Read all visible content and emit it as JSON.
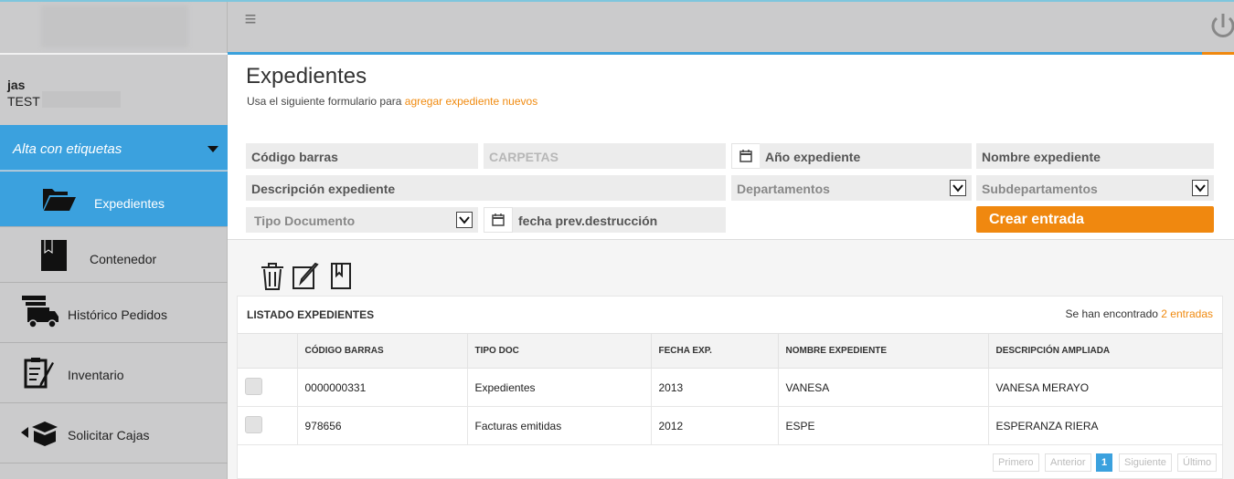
{
  "sidebar": {
    "user_name": "jas",
    "user_company": "TEST",
    "section": "Alta con etiquetas",
    "items": [
      {
        "label": "Expedientes",
        "icon": "folder-open-icon"
      },
      {
        "label": "Contenedor",
        "icon": "book-icon"
      },
      {
        "label": "Histórico Pedidos",
        "icon": "truck-icon"
      },
      {
        "label": "Inventario",
        "icon": "clipboard-pen-icon"
      },
      {
        "label": "Solicitar Cajas",
        "icon": "box-icon"
      }
    ]
  },
  "header": {
    "title": "Expedientes",
    "subtitle_prefix": "Usa el siguiente formulario para",
    "subtitle_link": "agregar expediente nuevos"
  },
  "form": {
    "codigo_barras": "Código barras",
    "carpetas": "CARPETAS",
    "ano_expediente": "Año expediente",
    "nombre_expediente": "Nombre expediente",
    "descripcion_expediente": "Descripción expediente",
    "departamentos": "Departamentos",
    "subdepartamentos": "Subdepartamentos",
    "tipo_documento": "Tipo Documento",
    "fecha_destruccion": "fecha prev.destrucción",
    "submit_label": "Crear entrada"
  },
  "toolbar": {
    "icons": [
      "trash-icon",
      "edit-icon",
      "bookmark-icon"
    ]
  },
  "listing": {
    "title": "LISTADO EXPEDIENTES",
    "found_prefix": "Se han encontrado",
    "found_count": "2 entradas",
    "columns": [
      "CÓDIGO BARRAS",
      "TIPO DOC",
      "FECHA EXP.",
      "NOMBRE EXPEDIENTE",
      "DESCRIPCIÓN AMPLIADA"
    ],
    "rows": [
      {
        "codigo": "0000000331",
        "tipo": "Expedientes",
        "fecha": "2013",
        "nombre": "VANESA",
        "descripcion": "VANESA MERAYO"
      },
      {
        "codigo": "978656",
        "tipo": "Facturas emitidas",
        "fecha": "2012",
        "nombre": "ESPE",
        "descripcion": "ESPERANZA RIERA"
      }
    ]
  },
  "pagination": {
    "first": "Primero",
    "prev": "Anterior",
    "current": "1",
    "next": "Siguiente",
    "last": "Último"
  },
  "colors": {
    "accent_blue": "#3ba1de",
    "accent_orange": "#f0880f"
  }
}
